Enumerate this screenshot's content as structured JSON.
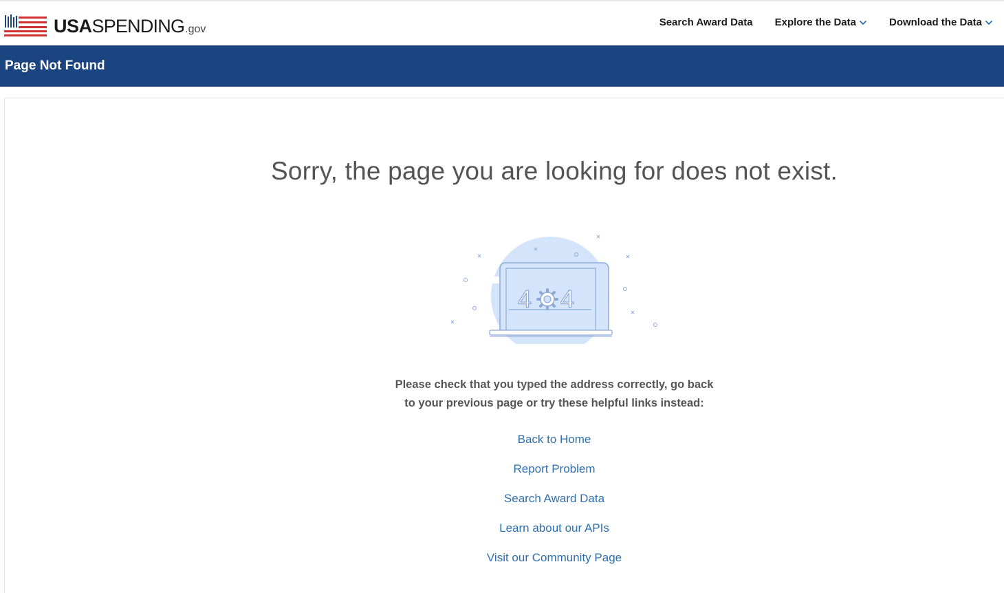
{
  "header": {
    "logo": {
      "usa": "USA",
      "spending": "SPENDING",
      "gov": ".gov",
      "mark_icon": "flag-bars-icon",
      "colors": {
        "red": "#d0302f",
        "blue": "#1b4580",
        "dark": "#1b1b1b"
      }
    },
    "nav": [
      {
        "label": "Search Award Data",
        "has_dropdown": false
      },
      {
        "label": "Explore the Data",
        "has_dropdown": true
      },
      {
        "label": "Download the Data",
        "has_dropdown": true
      }
    ],
    "accent": "#2e6fad"
  },
  "banner": {
    "title": "Page Not Found",
    "color": "#1b4580"
  },
  "main": {
    "headline": "Sorry, the page you are looking for does not exist.",
    "illustration": {
      "icon": "laptop-404-icon",
      "text_left": "4",
      "text_right": "4",
      "gear_icon": "gear-icon",
      "circle_color": "#d3e4fb",
      "stroke_color": "#8ca9d6"
    },
    "message_line1": "Please check that you typed the address correctly, go back",
    "message_line2": "to your previous page or try these helpful links instead:",
    "links": [
      "Back to Home",
      "Report Problem",
      "Search Award Data",
      "Learn about our APIs",
      "Visit our Community Page"
    ]
  }
}
